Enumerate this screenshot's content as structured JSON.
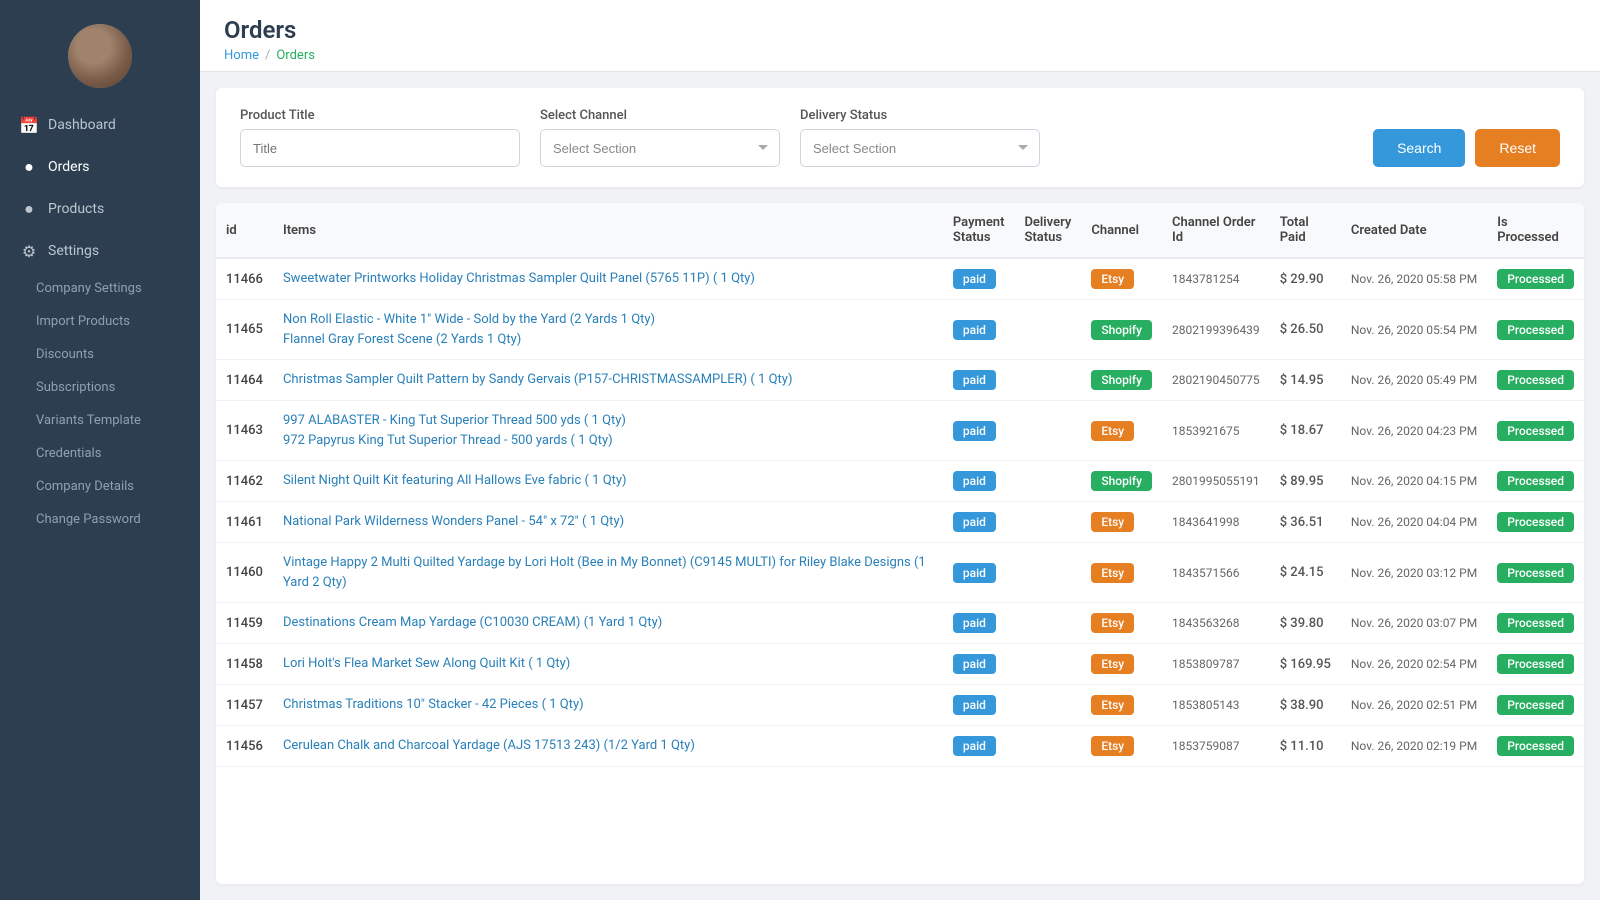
{
  "sidebar": {
    "nav_items": [
      {
        "id": "dashboard",
        "label": "Dashboard",
        "icon": "📅",
        "active": false
      },
      {
        "id": "orders",
        "label": "Orders",
        "icon": "●",
        "active": true
      },
      {
        "id": "products",
        "label": "Products",
        "icon": "●",
        "active": false
      },
      {
        "id": "settings",
        "label": "Settings",
        "icon": "⚙",
        "active": false
      }
    ],
    "sub_items": [
      {
        "id": "company-settings",
        "label": "Company Settings"
      },
      {
        "id": "import-products",
        "label": "Import Products"
      },
      {
        "id": "discounts",
        "label": "Discounts"
      },
      {
        "id": "subscriptions",
        "label": "Subscriptions"
      },
      {
        "id": "variants-template",
        "label": "Variants Template"
      },
      {
        "id": "credentials",
        "label": "Credentials"
      },
      {
        "id": "company-details",
        "label": "Company Details"
      },
      {
        "id": "change-password",
        "label": "Change Password"
      }
    ]
  },
  "header": {
    "title": "Orders",
    "breadcrumb_home": "Home",
    "breadcrumb_sep": "/",
    "breadcrumb_current": "Orders"
  },
  "filters": {
    "product_title_label": "Product Title",
    "product_title_placeholder": "Title",
    "select_channel_label": "Select Channel",
    "select_channel_placeholder": "Select Section",
    "delivery_status_label": "Delivery Status",
    "delivery_status_placeholder": "Select Section",
    "search_button": "Search",
    "reset_button": "Reset"
  },
  "table": {
    "columns": [
      "id",
      "Items",
      "Payment Status",
      "Delivery Status",
      "Channel",
      "Channel Order Id",
      "Total Paid",
      "Created Date",
      "Is Processed"
    ],
    "rows": [
      {
        "id": "11466",
        "items": "Sweetwater Printworks Holiday Christmas Sampler Quilt Panel (5765 11P) ( 1 Qty)",
        "items2": "",
        "payment": "paid",
        "delivery": "",
        "channel": "Etsy",
        "channel_order_id": "1843781254",
        "total": "$ 29.90",
        "date": "Nov. 26, 2020 05:58 PM",
        "processed": "Processed"
      },
      {
        "id": "11465",
        "items": "Non Roll Elastic - White 1\" Wide - Sold by the Yard (2 Yards 1 Qty)",
        "items2": "Flannel Gray Forest Scene (2 Yards 1 Qty)",
        "payment": "paid",
        "delivery": "",
        "channel": "Shopify",
        "channel_order_id": "2802199396439",
        "total": "$ 26.50",
        "date": "Nov. 26, 2020 05:54 PM",
        "processed": "Processed"
      },
      {
        "id": "11464",
        "items": "Christmas Sampler Quilt Pattern by Sandy Gervais (P157-CHRISTMASSAMPLER) ( 1 Qty)",
        "items2": "",
        "payment": "paid",
        "delivery": "",
        "channel": "Shopify",
        "channel_order_id": "2802190450775",
        "total": "$ 14.95",
        "date": "Nov. 26, 2020 05:49 PM",
        "processed": "Processed"
      },
      {
        "id": "11463",
        "items": "997 ALABASTER - King Tut Superior Thread 500 yds ( 1 Qty)",
        "items2": "972 Papyrus King Tut Superior Thread - 500 yards ( 1 Qty)",
        "payment": "paid",
        "delivery": "",
        "channel": "Etsy",
        "channel_order_id": "1853921675",
        "total": "$ 18.67",
        "date": "Nov. 26, 2020 04:23 PM",
        "processed": "Processed"
      },
      {
        "id": "11462",
        "items": "Silent Night Quilt Kit featuring All Hallows Eve fabric ( 1 Qty)",
        "items2": "",
        "payment": "paid",
        "delivery": "",
        "channel": "Shopify",
        "channel_order_id": "2801995055191",
        "total": "$ 89.95",
        "date": "Nov. 26, 2020 04:15 PM",
        "processed": "Processed"
      },
      {
        "id": "11461",
        "items": "National Park Wilderness Wonders Panel - 54\" x 72\" ( 1 Qty)",
        "items2": "",
        "payment": "paid",
        "delivery": "",
        "channel": "Etsy",
        "channel_order_id": "1843641998",
        "total": "$ 36.51",
        "date": "Nov. 26, 2020 04:04 PM",
        "processed": "Processed"
      },
      {
        "id": "11460",
        "items": "Vintage Happy 2 Multi Quilted Yardage by Lori Holt (Bee in My Bonnet) (C9145 MULTI) for Riley Blake Designs (1 Yard 2 Qty)",
        "items2": "",
        "payment": "paid",
        "delivery": "",
        "channel": "Etsy",
        "channel_order_id": "1843571566",
        "total": "$ 24.15",
        "date": "Nov. 26, 2020 03:12 PM",
        "processed": "Processed"
      },
      {
        "id": "11459",
        "items": "Destinations Cream Map Yardage (C10030 CREAM) (1 Yard 1 Qty)",
        "items2": "",
        "payment": "paid",
        "delivery": "",
        "channel": "Etsy",
        "channel_order_id": "1843563268",
        "total": "$ 39.80",
        "date": "Nov. 26, 2020 03:07 PM",
        "processed": "Processed"
      },
      {
        "id": "11458",
        "items": "Lori Holt's Flea Market Sew Along Quilt Kit ( 1 Qty)",
        "items2": "",
        "payment": "paid",
        "delivery": "",
        "channel": "Etsy",
        "channel_order_id": "1853809787",
        "total": "$ 169.95",
        "date": "Nov. 26, 2020 02:54 PM",
        "processed": "Processed"
      },
      {
        "id": "11457",
        "items": "Christmas Traditions 10\" Stacker - 42 Pieces ( 1 Qty)",
        "items2": "",
        "payment": "paid",
        "delivery": "",
        "channel": "Etsy",
        "channel_order_id": "1853805143",
        "total": "$ 38.90",
        "date": "Nov. 26, 2020 02:51 PM",
        "processed": "Processed"
      },
      {
        "id": "11456",
        "items": "Cerulean Chalk and Charcoal Yardage (AJS 17513 243) (1/2 Yard 1 Qty)",
        "items2": "",
        "payment": "paid",
        "delivery": "",
        "channel": "Etsy",
        "channel_order_id": "1853759087",
        "total": "$ 11.10",
        "date": "Nov. 26, 2020 02:19 PM",
        "processed": "Processed"
      }
    ]
  }
}
